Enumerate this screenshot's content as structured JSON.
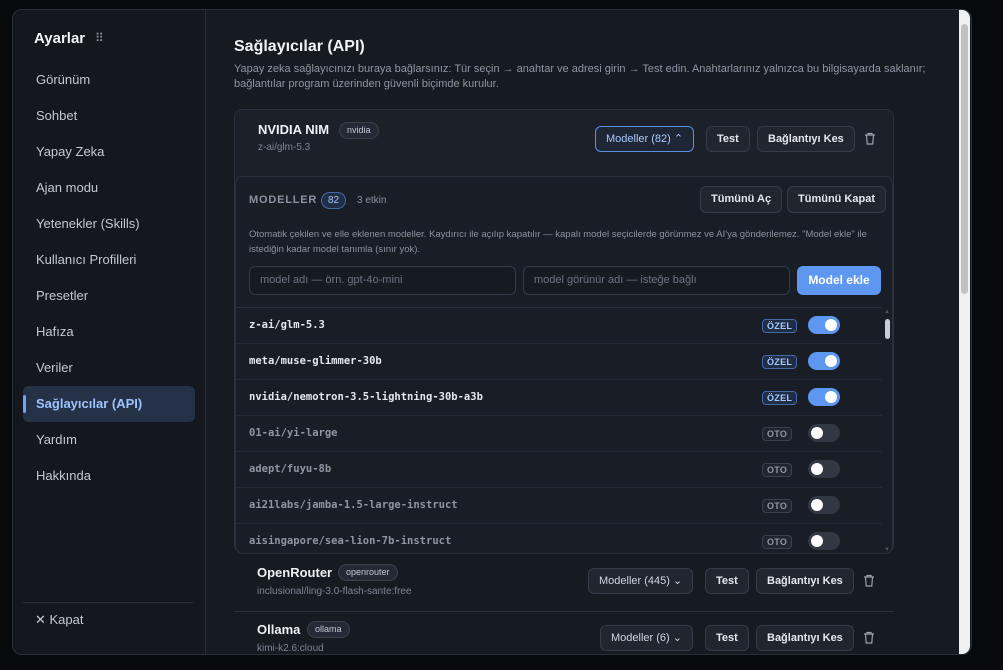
{
  "sidebar": {
    "title": "Ayarlar",
    "grip": "⠿",
    "items": [
      {
        "label": "Görünüm"
      },
      {
        "label": "Sohbet"
      },
      {
        "label": "Yapay Zeka"
      },
      {
        "label": "Ajan modu"
      },
      {
        "label": "Yetenekler (Skills)"
      },
      {
        "label": "Kullanıcı Profilleri"
      },
      {
        "label": "Presetler"
      },
      {
        "label": "Hafıza"
      },
      {
        "label": "Veriler"
      },
      {
        "label": "Sağlayıcılar (API)",
        "active": true
      },
      {
        "label": "Yardım"
      },
      {
        "label": "Hakkında"
      }
    ],
    "close_label": "✕ Kapat"
  },
  "main": {
    "title": "Sağlayıcılar (API)",
    "description": "Yapay zeka sağlayıcınızı buraya bağlarsınız: Tür seçin → anahtar ve adresi girin → Test edin. Anahtarlarınız yalnızca bu bilgisayarda saklanır; bağlantılar program üzerinden güvenli biçimde kurulur."
  },
  "providers": [
    {
      "name": "NVIDIA NIM",
      "tag": "nvidia",
      "model": "z-ai/glm-5.3",
      "models_button": "Modeller (82) ⌃",
      "test_label": "Test",
      "disconnect_label": "Bağlantıyı Kes",
      "expanded": true,
      "panel": {
        "label": "MODELLER",
        "count": "82",
        "active_text": "3 etkin",
        "expand_all": "Tümünü Aç",
        "collapse_all": "Tümünü Kapat",
        "info": "Otomatik çekilen ve elle eklenen modeller. Kaydırıcı ile açılıp kapatılır — kapalı model seçicilerde görünmez ve AI'ya gönderilemez. \"Model ekle\" ile istediğin kadar model tanımla (sınır yok).",
        "name_placeholder": "model adı — örn. gpt-4o-mini",
        "display_placeholder": "model görünür adı — isteğe bağlı",
        "add_label": "Model ekle",
        "rows": [
          {
            "name": "z-ai/glm-5.3",
            "badge": "ÖZEL",
            "type": "ozel",
            "enabled": true
          },
          {
            "name": "meta/muse-glimmer-30b",
            "badge": "ÖZEL",
            "type": "ozel",
            "enabled": true
          },
          {
            "name": "nvidia/nemotron-3.5-lightning-30b-a3b",
            "badge": "ÖZEL",
            "type": "ozel",
            "enabled": true
          },
          {
            "name": "01-ai/yi-large",
            "badge": "OTO",
            "type": "oto",
            "enabled": false
          },
          {
            "name": "adept/fuyu-8b",
            "badge": "OTO",
            "type": "oto",
            "enabled": false
          },
          {
            "name": "ai21labs/jamba-1.5-large-instruct",
            "badge": "OTO",
            "type": "oto",
            "enabled": false
          },
          {
            "name": "aisingapore/sea-lion-7b-instruct",
            "badge": "OTO",
            "type": "oto",
            "enabled": false
          }
        ]
      }
    },
    {
      "name": "OpenRouter",
      "tag": "openrouter",
      "model": "inclusional/ling-3.0-flash-sante:free",
      "models_button": "Modeller (445) ⌄",
      "test_label": "Test",
      "disconnect_label": "Bağlantıyı Kes"
    },
    {
      "name": "Ollama",
      "tag": "ollama",
      "model": "kimi-k2.6:cloud",
      "models_button": "Modeller (6) ⌄",
      "test_label": "Test",
      "disconnect_label": "Bağlantıyı Kes"
    }
  ],
  "colors": {
    "accent": "#5d97ef",
    "background": "#161a21",
    "sidebar_active": "#243147"
  }
}
